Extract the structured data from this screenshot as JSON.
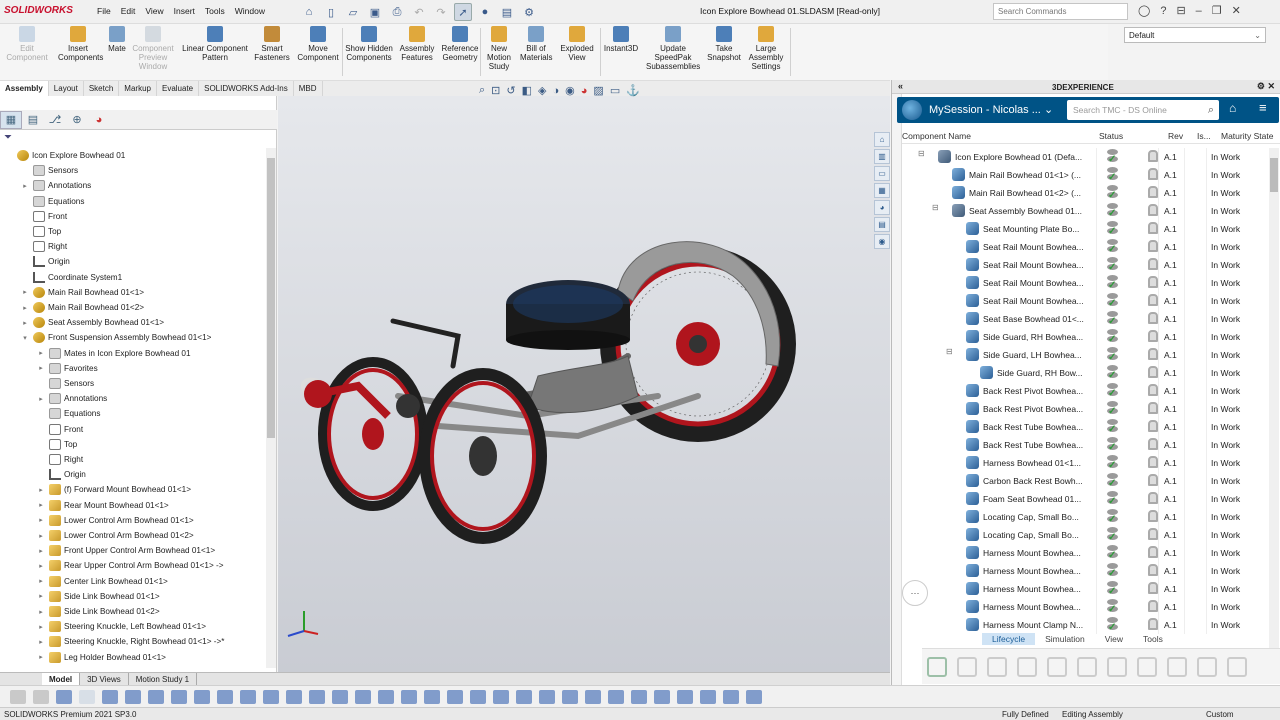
{
  "app": {
    "logo": "SOLIDWORKS",
    "menus": [
      "File",
      "Edit",
      "View",
      "Insert",
      "Tools",
      "Window"
    ],
    "document_title": "Icon Explore Bowhead 01.SLDASM [Read-only]",
    "search_placeholder": "Search Commands"
  },
  "commands": [
    {
      "label": "Edit Component",
      "enabled": false
    },
    {
      "label": "Insert Components",
      "enabled": true
    },
    {
      "label": "Mate",
      "enabled": true
    },
    {
      "label": "Component Preview Window",
      "enabled": false
    },
    {
      "label": "Linear Component Pattern",
      "enabled": true
    },
    {
      "label": "Smart Fasteners",
      "enabled": true
    },
    {
      "label": "Move Component",
      "enabled": true
    },
    {
      "label": "Show Hidden Components",
      "enabled": true
    },
    {
      "label": "Assembly Features",
      "enabled": true
    },
    {
      "label": "Reference Geometry",
      "enabled": true
    },
    {
      "label": "New Motion Study",
      "enabled": true
    },
    {
      "label": "Bill of Materials",
      "enabled": true
    },
    {
      "label": "Exploded View",
      "enabled": true
    },
    {
      "label": "Instant3D",
      "enabled": true
    },
    {
      "label": "Update SpeedPak Subassemblies",
      "enabled": true
    },
    {
      "label": "Take Snapshot",
      "enabled": true
    },
    {
      "label": "Large Assembly Settings",
      "enabled": true
    }
  ],
  "configuration": "Default",
  "command_tabs": [
    "Assembly",
    "Layout",
    "Sketch",
    "Markup",
    "Evaluate",
    "SOLIDWORKS Add-Ins",
    "MBD"
  ],
  "tree": [
    {
      "label": "Icon Explore Bowhead 01",
      "depth": 0,
      "icon": "asm",
      "exp": ""
    },
    {
      "label": "Sensors",
      "depth": 1,
      "icon": "folder",
      "exp": ""
    },
    {
      "label": "Annotations",
      "depth": 1,
      "icon": "folder",
      "exp": "▸"
    },
    {
      "label": "Equations",
      "depth": 1,
      "icon": "folder",
      "exp": ""
    },
    {
      "label": "Front",
      "depth": 1,
      "icon": "plane",
      "exp": ""
    },
    {
      "label": "Top",
      "depth": 1,
      "icon": "plane",
      "exp": ""
    },
    {
      "label": "Right",
      "depth": 1,
      "icon": "plane",
      "exp": ""
    },
    {
      "label": "Origin",
      "depth": 1,
      "icon": "origin",
      "exp": ""
    },
    {
      "label": "Coordinate System1",
      "depth": 1,
      "icon": "origin",
      "exp": ""
    },
    {
      "label": "Main Rail Bowhead 01<1>",
      "depth": 1,
      "icon": "asm",
      "exp": "▸"
    },
    {
      "label": "Main Rail Bowhead 01<2>",
      "depth": 1,
      "icon": "asm",
      "exp": "▸"
    },
    {
      "label": "Seat Assembly Bowhead 01<1>",
      "depth": 1,
      "icon": "asm",
      "exp": "▸"
    },
    {
      "label": "Front Suspension Assembly Bowhead 01<1>",
      "depth": 1,
      "icon": "asm",
      "exp": "▾"
    },
    {
      "label": "Mates in Icon Explore Bowhead 01",
      "depth": 2,
      "icon": "folder",
      "exp": "▸"
    },
    {
      "label": "Favorites",
      "depth": 2,
      "icon": "folder",
      "exp": "▸"
    },
    {
      "label": "Sensors",
      "depth": 2,
      "icon": "folder",
      "exp": ""
    },
    {
      "label": "Annotations",
      "depth": 2,
      "icon": "folder",
      "exp": "▸"
    },
    {
      "label": "Equations",
      "depth": 2,
      "icon": "folder",
      "exp": ""
    },
    {
      "label": "Front",
      "depth": 2,
      "icon": "plane",
      "exp": ""
    },
    {
      "label": "Top",
      "depth": 2,
      "icon": "plane",
      "exp": ""
    },
    {
      "label": "Right",
      "depth": 2,
      "icon": "plane",
      "exp": ""
    },
    {
      "label": "Origin",
      "depth": 2,
      "icon": "origin",
      "exp": ""
    },
    {
      "label": "(f) Forward Mount Bowhead 01<1>",
      "depth": 2,
      "icon": "part",
      "exp": "▸"
    },
    {
      "label": "Rear Mount Bowhead 01<1>",
      "depth": 2,
      "icon": "part",
      "exp": "▸"
    },
    {
      "label": "Lower Control Arm Bowhead 01<1>",
      "depth": 2,
      "icon": "part",
      "exp": "▸"
    },
    {
      "label": "Lower Control Arm Bowhead 01<2>",
      "depth": 2,
      "icon": "part",
      "exp": "▸"
    },
    {
      "label": "Front Upper Control Arm Bowhead 01<1>",
      "depth": 2,
      "icon": "part",
      "exp": "▸"
    },
    {
      "label": "Rear Upper Control Arm Bowhead 01<1> ->",
      "depth": 2,
      "icon": "part",
      "exp": "▸"
    },
    {
      "label": "Center Link Bowhead 01<1>",
      "depth": 2,
      "icon": "part",
      "exp": "▸"
    },
    {
      "label": "Side Link Bowhead 01<1>",
      "depth": 2,
      "icon": "part",
      "exp": "▸"
    },
    {
      "label": "Side Link Bowhead 01<2>",
      "depth": 2,
      "icon": "part",
      "exp": "▸"
    },
    {
      "label": "Steering Knuckle, Left Bowhead 01<1>",
      "depth": 2,
      "icon": "part",
      "exp": "▸"
    },
    {
      "label": "Steering Knuckle, Right Bowhead 01<1> ->*",
      "depth": 2,
      "icon": "part",
      "exp": "▸"
    },
    {
      "label": "Leg Holder Bowhead 01<1>",
      "depth": 2,
      "icon": "part",
      "exp": "▸"
    }
  ],
  "bottom_tabs": [
    "Model",
    "3D Views",
    "Motion Study 1"
  ],
  "status": {
    "product": "SOLIDWORKS Premium 2021 SP3.0",
    "state": "Fully Defined",
    "mode": "Editing Assembly",
    "units": "Custom"
  },
  "experience": {
    "title": "3DEXPERIENCE",
    "session": "MySession - Nicolas ...",
    "search_placeholder": "Search TMC - DS Online",
    "columns": {
      "name": "Component Name",
      "status": "Status",
      "rev": "Rev",
      "is": "Is...",
      "maturity": "Maturity State"
    },
    "rows": [
      {
        "name": "Icon Explore Bowhead 01 (Defa...",
        "indent": 0,
        "toggle": "−",
        "rev": "A.1",
        "maturity": "In Work",
        "asm": true
      },
      {
        "name": "Main Rail Bowhead 01<1> (...",
        "indent": 1,
        "toggle": "",
        "rev": "A.1",
        "maturity": "In Work",
        "asm": false
      },
      {
        "name": "Main Rail Bowhead 01<2> (...",
        "indent": 1,
        "toggle": "",
        "rev": "A.1",
        "maturity": "In Work",
        "asm": false
      },
      {
        "name": "Seat Assembly Bowhead 01...",
        "indent": 1,
        "toggle": "−",
        "rev": "A.1",
        "maturity": "In Work",
        "asm": true
      },
      {
        "name": "Seat Mounting Plate Bo...",
        "indent": 2,
        "toggle": "",
        "rev": "A.1",
        "maturity": "In Work",
        "asm": false
      },
      {
        "name": "Seat Rail Mount Bowhea...",
        "indent": 2,
        "toggle": "",
        "rev": "A.1",
        "maturity": "In Work",
        "asm": false
      },
      {
        "name": "Seat Rail Mount Bowhea...",
        "indent": 2,
        "toggle": "",
        "rev": "A.1",
        "maturity": "In Work",
        "asm": false
      },
      {
        "name": "Seat Rail Mount Bowhea...",
        "indent": 2,
        "toggle": "",
        "rev": "A.1",
        "maturity": "In Work",
        "asm": false
      },
      {
        "name": "Seat Rail Mount Bowhea...",
        "indent": 2,
        "toggle": "",
        "rev": "A.1",
        "maturity": "In Work",
        "asm": false
      },
      {
        "name": "Seat Base Bowhead 01<...",
        "indent": 2,
        "toggle": "",
        "rev": "A.1",
        "maturity": "In Work",
        "asm": false
      },
      {
        "name": "Side Guard, RH Bowhea...",
        "indent": 2,
        "toggle": "",
        "rev": "A.1",
        "maturity": "In Work",
        "asm": false
      },
      {
        "name": "Side Guard, LH Bowhea...",
        "indent": 2,
        "toggle": "−",
        "rev": "A.1",
        "maturity": "In Work",
        "asm": false
      },
      {
        "name": "Side Guard, RH Bow...",
        "indent": 3,
        "toggle": "",
        "rev": "A.1",
        "maturity": "In Work",
        "asm": false
      },
      {
        "name": "Back Rest Pivot Bowhea...",
        "indent": 2,
        "toggle": "",
        "rev": "A.1",
        "maturity": "In Work",
        "asm": false
      },
      {
        "name": "Back Rest Pivot Bowhea...",
        "indent": 2,
        "toggle": "",
        "rev": "A.1",
        "maturity": "In Work",
        "asm": false
      },
      {
        "name": "Back Rest Tube Bowhea...",
        "indent": 2,
        "toggle": "",
        "rev": "A.1",
        "maturity": "In Work",
        "asm": false
      },
      {
        "name": "Back Rest Tube Bowhea...",
        "indent": 2,
        "toggle": "",
        "rev": "A.1",
        "maturity": "In Work",
        "asm": false
      },
      {
        "name": "Harness Bowhead 01<1...",
        "indent": 2,
        "toggle": "",
        "rev": "A.1",
        "maturity": "In Work",
        "asm": false
      },
      {
        "name": "Carbon Back Rest Bowh...",
        "indent": 2,
        "toggle": "",
        "rev": "A.1",
        "maturity": "In Work",
        "asm": false
      },
      {
        "name": "Foam Seat Bowhead 01...",
        "indent": 2,
        "toggle": "",
        "rev": "A.1",
        "maturity": "In Work",
        "asm": false
      },
      {
        "name": "Locating Cap, Small Bo...",
        "indent": 2,
        "toggle": "",
        "rev": "A.1",
        "maturity": "In Work",
        "asm": false
      },
      {
        "name": "Locating Cap, Small Bo...",
        "indent": 2,
        "toggle": "",
        "rev": "A.1",
        "maturity": "In Work",
        "asm": false
      },
      {
        "name": "Harness Mount Bowhea...",
        "indent": 2,
        "toggle": "",
        "rev": "A.1",
        "maturity": "In Work",
        "asm": false
      },
      {
        "name": "Harness Mount Bowhea...",
        "indent": 2,
        "toggle": "",
        "rev": "A.1",
        "maturity": "In Work",
        "asm": false
      },
      {
        "name": "Harness Mount Bowhea...",
        "indent": 2,
        "toggle": "",
        "rev": "A.1",
        "maturity": "In Work",
        "asm": false
      },
      {
        "name": "Harness Mount Bowhea...",
        "indent": 2,
        "toggle": "",
        "rev": "A.1",
        "maturity": "In Work",
        "asm": false
      },
      {
        "name": "Harness Mount Clamp N...",
        "indent": 2,
        "toggle": "",
        "rev": "A.1",
        "maturity": "In Work",
        "asm": false
      }
    ],
    "bottom_tabs": [
      "Lifecycle",
      "Simulation",
      "View",
      "Tools"
    ]
  },
  "colors": {
    "accent": "#005386",
    "frame": "#c8102e",
    "brand": "#c8102e"
  }
}
